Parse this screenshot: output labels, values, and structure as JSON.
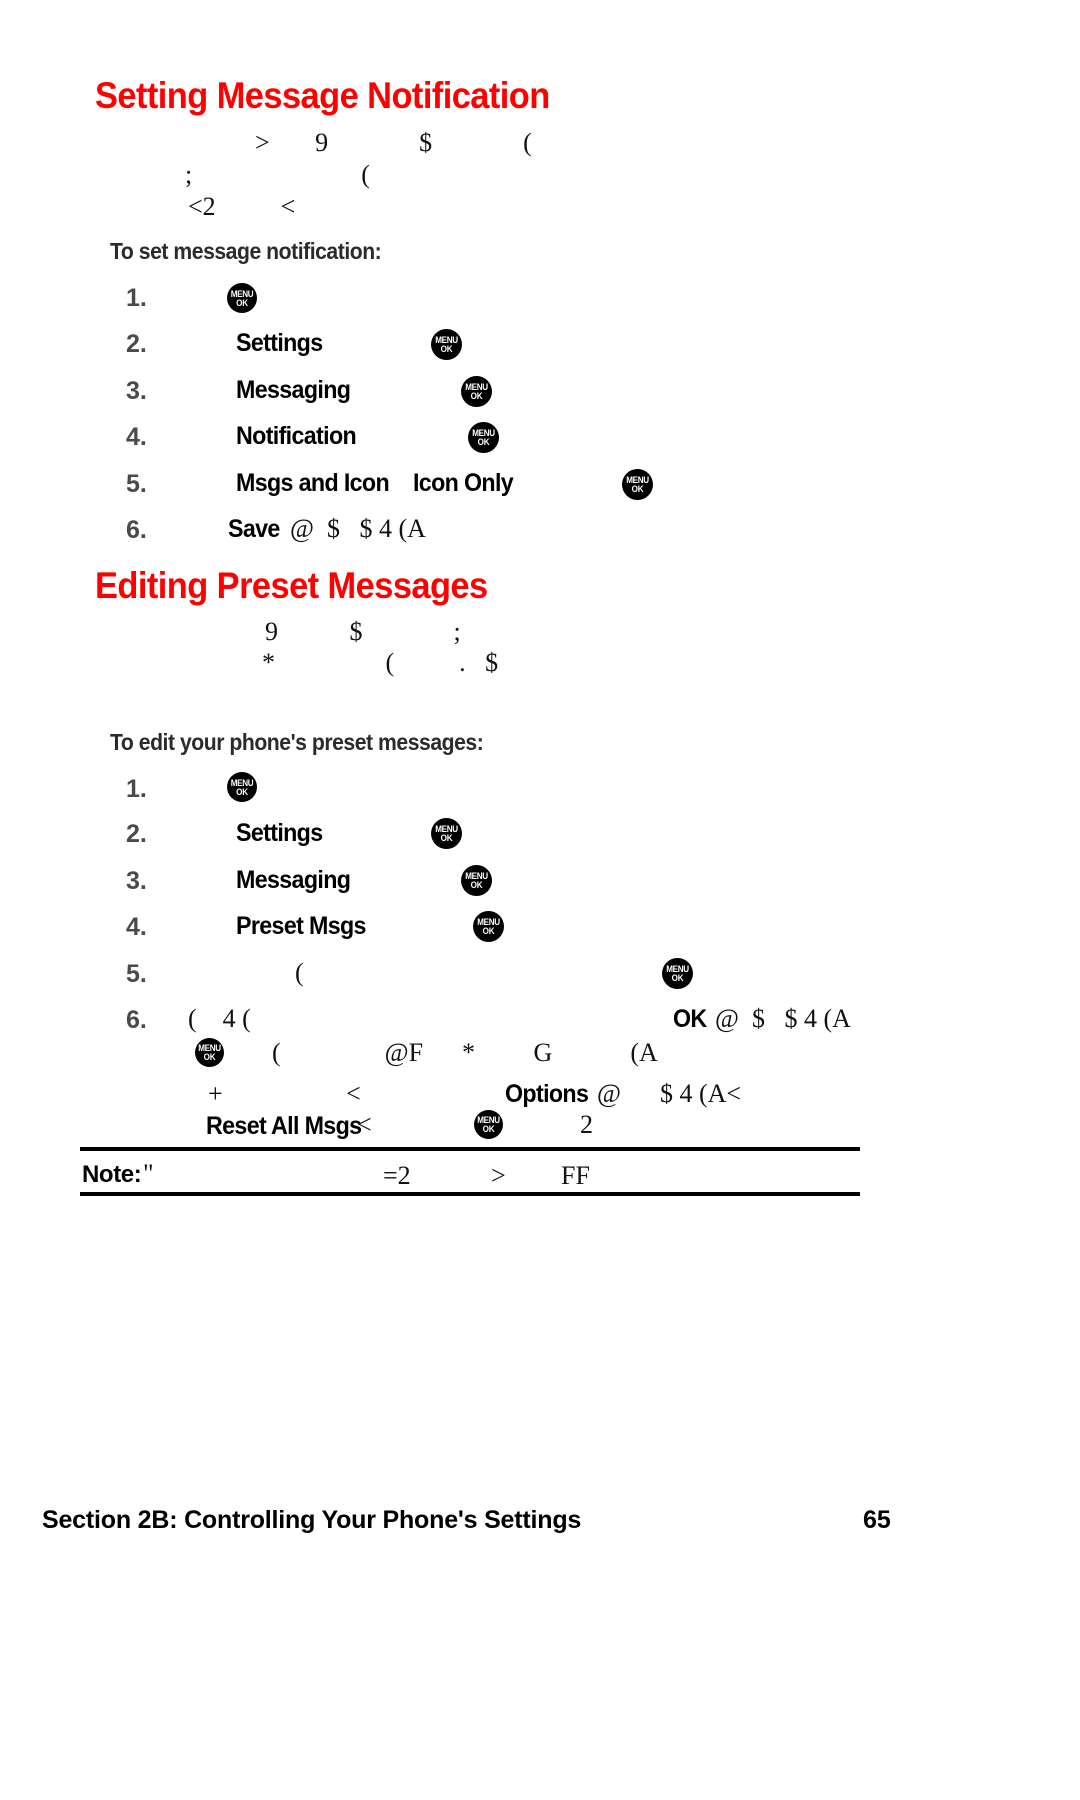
{
  "page": {
    "number": "65",
    "footer_title": "Section 2B: Controlling Your Phone's Settings",
    "accent_color": "#ff0000",
    "text_color": "#000000"
  },
  "sections": [
    {
      "heading": "Setting Message Notification",
      "intro_lines": [
        ">       9              $              (",
        ";                          (",
        "<2          <"
      ],
      "procedure_title": "To set message notification:",
      "steps": [
        {
          "num": "1.",
          "label": "",
          "label2": "",
          "trailing": "",
          "icon": "menu-ok-icon"
        },
        {
          "num": "2.",
          "label": "Settings",
          "label2": "",
          "trailing": "",
          "icon": "menu-ok-icon"
        },
        {
          "num": "3.",
          "label": "Messaging",
          "label2": "",
          "trailing": "",
          "icon": "menu-ok-icon"
        },
        {
          "num": "4.",
          "label": "Notification",
          "label2": "",
          "trailing": "",
          "icon": "menu-ok-icon"
        },
        {
          "num": "5.",
          "label": "Msgs and Icon",
          "label2": "Icon Only",
          "trailing": "",
          "icon": "menu-ok-icon"
        },
        {
          "num": "6.",
          "label": "Save",
          "label2": "",
          "trailing": "@  $   $ 4 (A",
          "icon": ""
        }
      ]
    },
    {
      "heading": "Editing Preset Messages",
      "intro_lines": [
        "9           $              ;",
        "*                 (          .   $"
      ],
      "procedure_title": "To edit your phone's preset messages:",
      "steps": [
        {
          "num": "1.",
          "label": "",
          "label2": "",
          "trailing": "",
          "icon": "menu-ok-icon"
        },
        {
          "num": "2.",
          "label": "Settings",
          "label2": "",
          "trailing": "",
          "icon": "menu-ok-icon"
        },
        {
          "num": "3.",
          "label": "Messaging",
          "label2": "",
          "trailing": "",
          "icon": "menu-ok-icon"
        },
        {
          "num": "4.",
          "label": "Preset Msgs",
          "label2": "",
          "trailing": "",
          "icon": "menu-ok-icon"
        },
        {
          "num": "5.",
          "label": "",
          "label2": "",
          "trailing": "(",
          "icon": "menu-ok-icon"
        },
        {
          "num": "6.",
          "label": "",
          "label2": "",
          "trailing": "(    4 (",
          "icon": ""
        }
      ],
      "step6_extra": {
        "bold_ok": "OK",
        "after_ok": "@  $   $ 4 (A",
        "line2_stray_a": "(                @F      *         G            (A",
        "line3_stray_a": "+                   <",
        "line3_bold": "Options",
        "line3_stray_b": "@      $ 4 (A<",
        "line4_bold": "Reset All Msgs",
        "line4_stray_a": "<",
        "line4_stray_b": "2"
      }
    }
  ],
  "note": {
    "label": "Note:",
    "stray_a": "\"",
    "stray_b": "=2",
    "stray_c": ">",
    "stray_d": "FF"
  },
  "icons": {
    "menu_ok": {
      "line1": "MENU",
      "line2": "OK",
      "name": "menu-ok-icon"
    }
  }
}
